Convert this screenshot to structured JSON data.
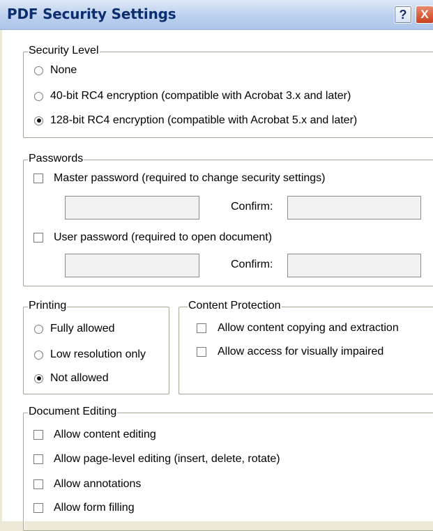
{
  "window": {
    "title": "PDF Security Settings",
    "help_label": "?",
    "close_label": "X"
  },
  "security_level": {
    "title": "Security Level",
    "options": [
      {
        "label": "None",
        "selected": false
      },
      {
        "label": "40-bit RC4 encryption (compatible with Acrobat 3.x and later)",
        "selected": false
      },
      {
        "label": "128-bit RC4 encryption (compatible with Acrobat 5.x and later)",
        "selected": true
      }
    ]
  },
  "passwords": {
    "title": "Passwords",
    "master_label": "Master password  (required to change security settings)",
    "master_checked": false,
    "master_value": "",
    "master_confirm_label": "Confirm:",
    "master_confirm_value": "",
    "user_label": "User password  (required to open document)",
    "user_checked": false,
    "user_value": "",
    "user_confirm_label": "Confirm:",
    "user_confirm_value": ""
  },
  "printing": {
    "title": "Printing",
    "options": [
      {
        "label": "Fully allowed",
        "selected": false
      },
      {
        "label": "Low resolution only",
        "selected": false
      },
      {
        "label": "Not allowed",
        "selected": true
      }
    ]
  },
  "content_protection": {
    "title": "Content Protection",
    "options": [
      {
        "label": "Allow content copying and extraction",
        "checked": false
      },
      {
        "label": "Allow access for visually impaired",
        "checked": false
      }
    ]
  },
  "document_editing": {
    "title": "Document Editing",
    "options": [
      {
        "label": "Allow content editing",
        "checked": false
      },
      {
        "label": "Allow page-level editing (insert, delete, rotate)",
        "checked": false
      },
      {
        "label": "Allow annotations",
        "checked": false
      },
      {
        "label": "Allow form filling",
        "checked": false
      }
    ]
  }
}
